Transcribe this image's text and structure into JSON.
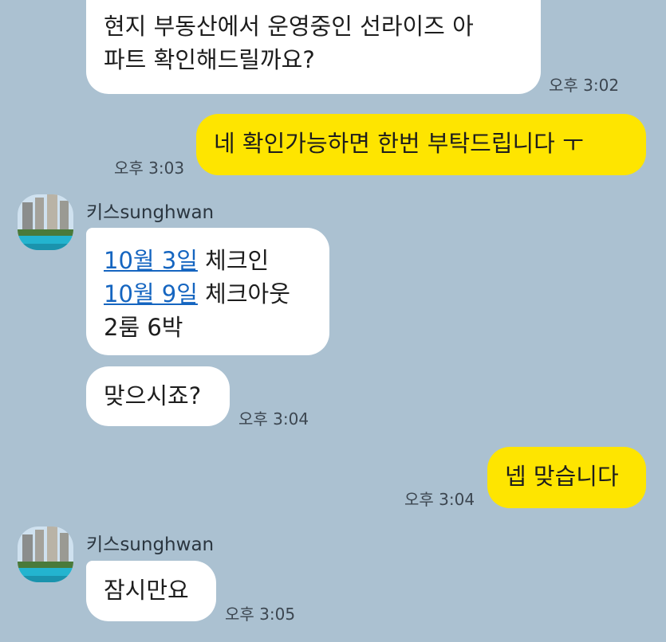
{
  "messages": {
    "m1": {
      "line1": "현지 부동산에서 운영중인 선라이즈 아",
      "line2": "파트 확인해드릴까요?",
      "time": "오후 3:02"
    },
    "m2": {
      "text": "네 확인가능하면 한번 부탁드립니다 ㅜ",
      "time": "오후 3:03"
    },
    "sender1": {
      "name": "키스sunghwan"
    },
    "m3": {
      "l1_link": "10월 3일",
      "l1_text": " 체크인",
      "l2_link": "10월 9일",
      "l2_text": " 체크아웃",
      "l3_text": "2룸 6박"
    },
    "m4": {
      "text": "맞으시죠?",
      "time": "오후 3:04"
    },
    "m5": {
      "text": "넵 맞습니다",
      "time": "오후 3:04"
    },
    "sender2": {
      "name": "키스sunghwan"
    },
    "m6": {
      "text": "잠시만요",
      "time": "오후 3:05"
    }
  },
  "colors": {
    "background": "#abc1d1",
    "incoming_bubble": "#ffffff",
    "outgoing_bubble": "#fee500",
    "link": "#1565c0"
  },
  "icons": {
    "avatar": "avatar-icon"
  }
}
